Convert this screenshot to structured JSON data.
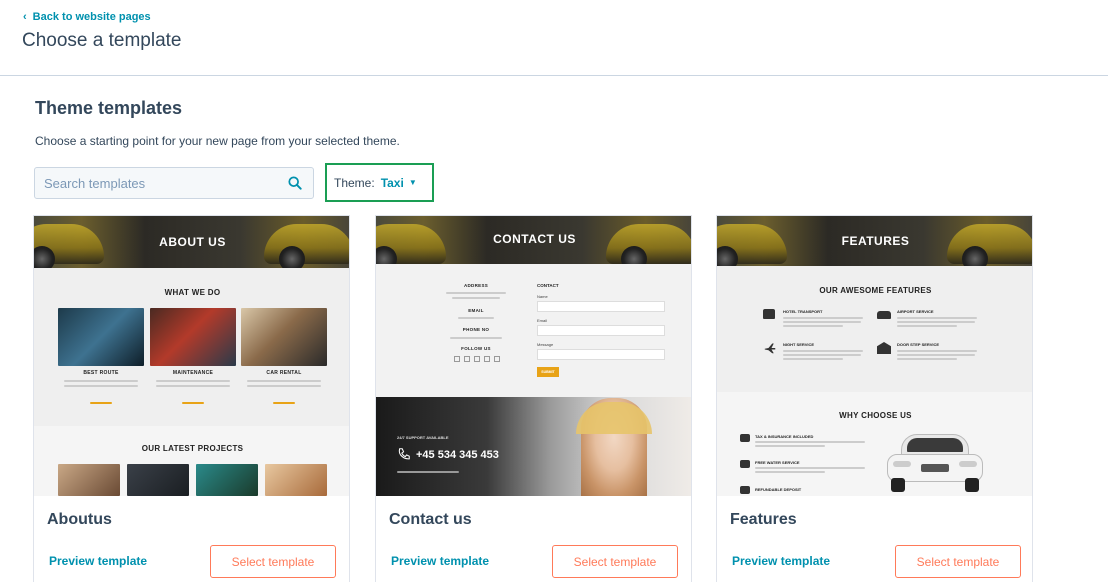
{
  "header": {
    "back_label": "Back to website pages",
    "title": "Choose a template"
  },
  "section": {
    "title": "Theme templates",
    "description": "Choose a starting point for your new page from your selected theme."
  },
  "search": {
    "placeholder": "Search templates",
    "value": ""
  },
  "theme_filter": {
    "label": "Theme:",
    "value": "Taxi"
  },
  "cards": [
    {
      "name": "Aboutus",
      "preview_label": "Preview template",
      "select_label": "Select template",
      "thumb": {
        "hero_title": "ABOUT US",
        "heading1": "WHAT WE DO",
        "items": [
          "BEST ROUTE",
          "MAINTENANCE",
          "CAR RENTAL"
        ],
        "heading2": "OUR LATEST PROJECTS"
      }
    },
    {
      "name": "Contact us",
      "preview_label": "Preview template",
      "select_label": "Select template",
      "thumb": {
        "hero_title": "CONTACT US",
        "address_label": "ADDRESS",
        "email_label": "EMAIL",
        "phone_label": "PHONE NO",
        "follow_label": "FOLLOW US",
        "form_title": "CONTACT",
        "field_name": "Name",
        "field_email": "Email",
        "field_message": "Message",
        "submit_label": "SUBMIT",
        "support_label": "24/7 SUPPORT AVAILABLE",
        "support_phone": "+45 534 345 453"
      }
    },
    {
      "name": "Features",
      "preview_label": "Preview template",
      "select_label": "Select template",
      "thumb": {
        "hero_title": "FEATURES",
        "heading1": "OUR AWESOME FEATURES",
        "features": [
          "HOTEL TRANSPORT",
          "AIRPORT SERVICE",
          "NIGHT SERVICE",
          "DOOR STEP SERVICE"
        ],
        "heading2": "WHY CHOOSE US",
        "reasons": [
          "TAX & INSURANCE INCLUDED",
          "FREE WATER SERVICE",
          "REFUNDABLE DEPOSIT"
        ]
      }
    }
  ],
  "colors": {
    "link": "#0091ae",
    "accent": "#ff7a59",
    "theme_highlight": "#1a9e54",
    "text": "#33475b"
  }
}
